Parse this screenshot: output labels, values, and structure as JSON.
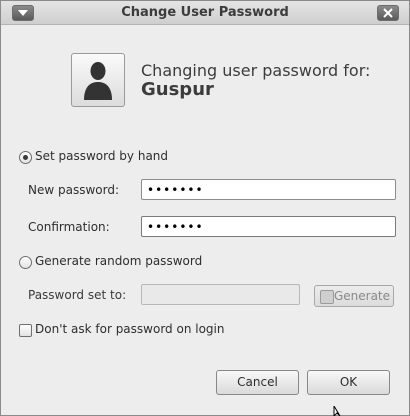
{
  "window": {
    "title": "Change User Password"
  },
  "header": {
    "line": "Changing user password for:",
    "username": "Guspur"
  },
  "options": {
    "set_by_hand": "Set password by hand",
    "new_password_label": "New password:",
    "new_password_value": "•••••••",
    "confirmation_label": "Confirmation:",
    "confirmation_value": "•••••••",
    "generate_random": "Generate random password",
    "password_set_to_label": "Password set to:",
    "password_set_to_value": "",
    "generate_button": "Generate",
    "dont_ask_login": "Don't ask for password on login"
  },
  "buttons": {
    "cancel": "Cancel",
    "ok": "OK"
  }
}
